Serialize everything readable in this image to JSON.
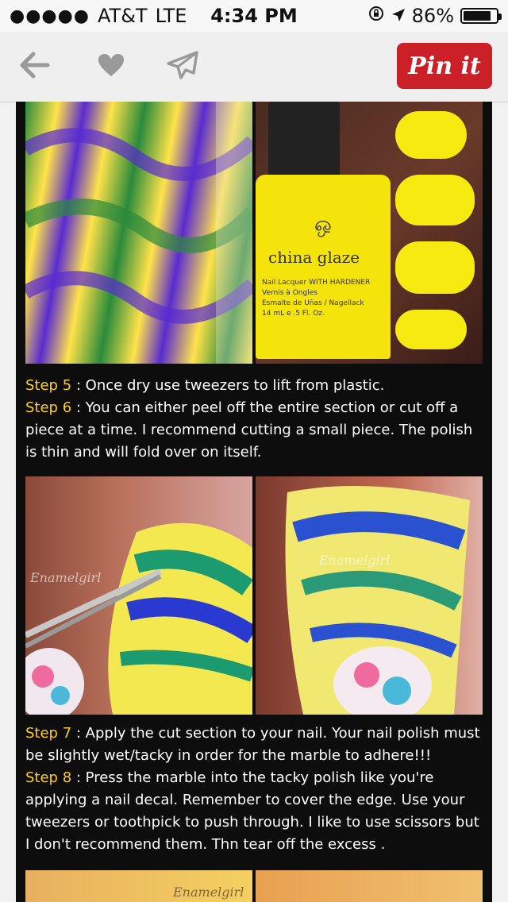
{
  "status_bar": {
    "carrier": "AT&T",
    "network": "LTE",
    "time": "4:34 PM",
    "battery_text": "86%",
    "battery_level": 0.86
  },
  "toolbar": {
    "pin_label": "Pin it"
  },
  "content": {
    "bottle_brand": "china glaze",
    "bottle_lines": [
      "Nail Lacquer WITH HARDENER",
      "Vernis à Ongles",
      "Esmalte de Uñas / Nagellack",
      "14 mL e .5 Fl. Oz."
    ],
    "watermark_1": "Enamelgirl",
    "watermark_2": "Enamelgirl",
    "watermark_3": "Enamelgirl",
    "steps_a": {
      "step5_label": "Step 5",
      "step5_text": " : Once dry use tweezers to lift from plastic.",
      "step6_label": "Step 6",
      "step6_text": " : You can either peel off the entire section or cut off a piece at a time. I recommend cutting a small piece. The polish is thin and will fold over on itself."
    },
    "steps_b": {
      "step7_label": "Step 7",
      "step7_text": " : Apply the cut section to your nail. Your nail polish must be slightly wet/tacky in order for the marble to adhere!!!",
      "step8_label": "Step 8",
      "step8_text": " : Press the marble into the tacky polish like you're applying a nail decal. Remember to cover the edge. Use your tweezers or toothpick to push through. I like to use scissors but I don't recommend them. Thn tear off the excess ."
    }
  },
  "colors": {
    "step_label": "#ffcc1a",
    "pin_red": "#cb2027"
  }
}
